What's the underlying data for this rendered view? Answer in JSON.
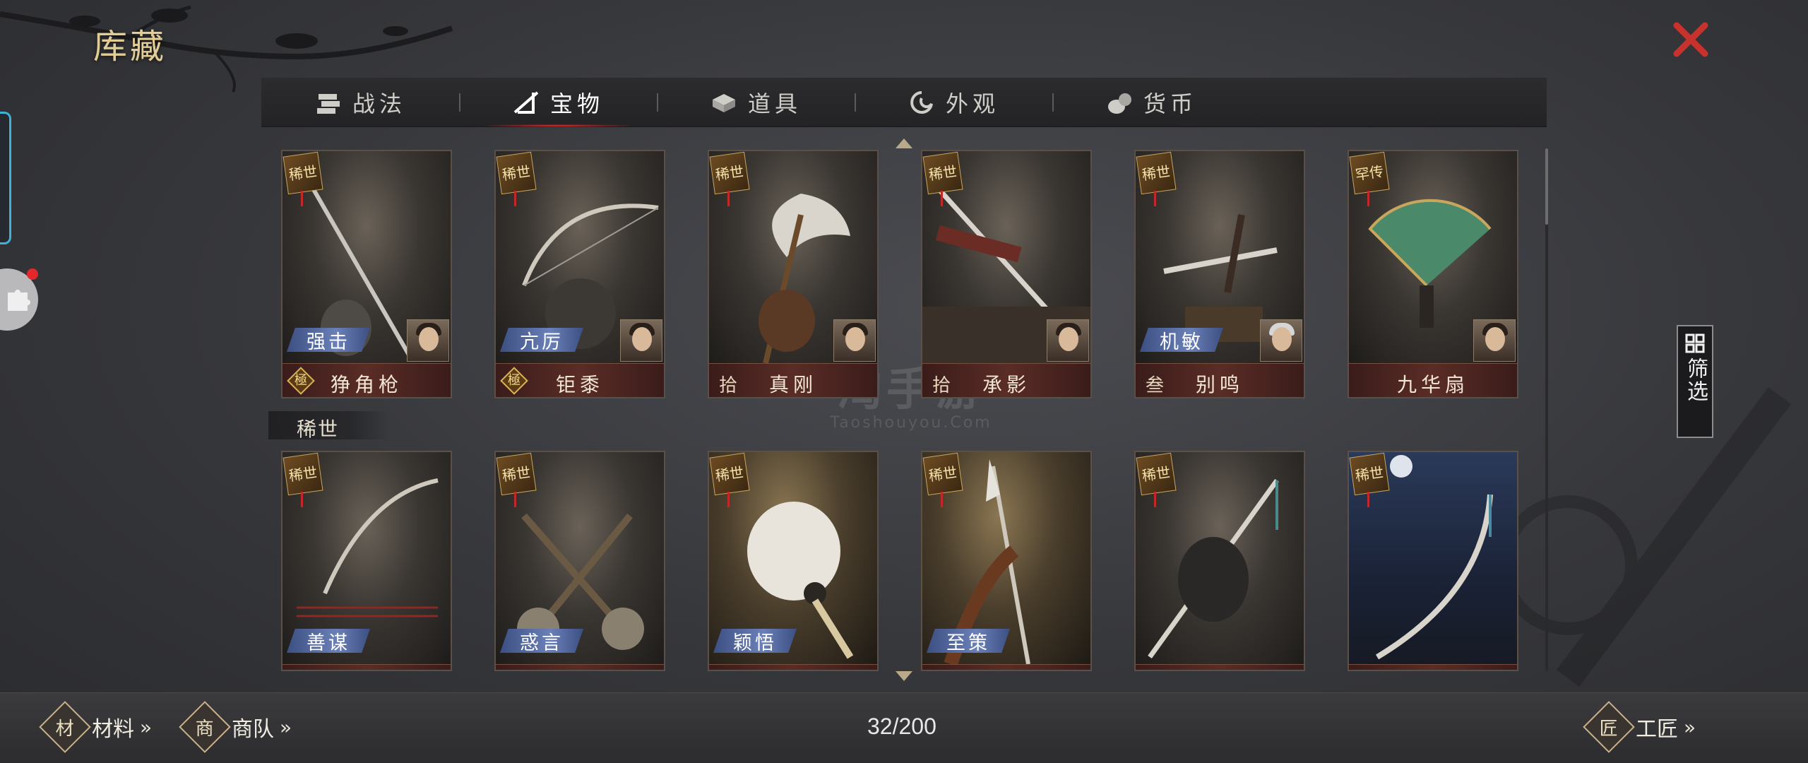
{
  "title": "库藏",
  "tabs": [
    {
      "label": "战法",
      "icon": "scroll-bundle-icon",
      "active": false
    },
    {
      "label": "宝物",
      "icon": "bow-treasure-icon",
      "active": true
    },
    {
      "label": "道具",
      "icon": "item-box-icon",
      "active": false
    },
    {
      "label": "外观",
      "icon": "appearance-swirl-icon",
      "active": false
    },
    {
      "label": "货币",
      "icon": "coin-bag-icon",
      "active": false
    }
  ],
  "filter_label": "筛选",
  "section_label": "稀世",
  "row1_cards": [
    {
      "rarity": "稀世",
      "skill": "强击",
      "level_mark": "極",
      "name": "狰角枪",
      "has_portrait": true
    },
    {
      "rarity": "稀世",
      "skill": "亢厉",
      "level_mark": "極",
      "name": "钜黍",
      "has_portrait": true
    },
    {
      "rarity": "稀世",
      "skill": "",
      "level_mark": "拾",
      "name": "真刚",
      "has_portrait": true
    },
    {
      "rarity": "稀世",
      "skill": "",
      "level_mark": "拾",
      "name": "承影",
      "has_portrait": true
    },
    {
      "rarity": "稀世",
      "skill": "机敏",
      "level_mark": "叁",
      "name": "别鸣",
      "has_portrait": true
    },
    {
      "rarity": "罕传",
      "skill": "",
      "level_mark": "",
      "name": "九华扇",
      "has_portrait": true
    }
  ],
  "row2_cards": [
    {
      "rarity": "稀世",
      "skill": "善谋"
    },
    {
      "rarity": "稀世",
      "skill": "惑言"
    },
    {
      "rarity": "稀世",
      "skill": "颖悟"
    },
    {
      "rarity": "稀世",
      "skill": "至策"
    },
    {
      "rarity": "稀世",
      "skill": ""
    },
    {
      "rarity": "稀世",
      "skill": ""
    }
  ],
  "watermark": {
    "big": "淘手游",
    "small": "Taoshouyou.Com"
  },
  "bottom": {
    "materials": {
      "icon_char": "材",
      "label": "材料",
      "chev": "»"
    },
    "caravan": {
      "icon_char": "商",
      "label": "商队",
      "chev": "»"
    },
    "craftsman": {
      "icon_char": "匠",
      "label": "工匠",
      "chev": "»"
    },
    "count": "32/200"
  },
  "colors": {
    "accent_red": "#e5302a",
    "gold": "#e2cd96",
    "skill_blue": "#6a80b8"
  }
}
